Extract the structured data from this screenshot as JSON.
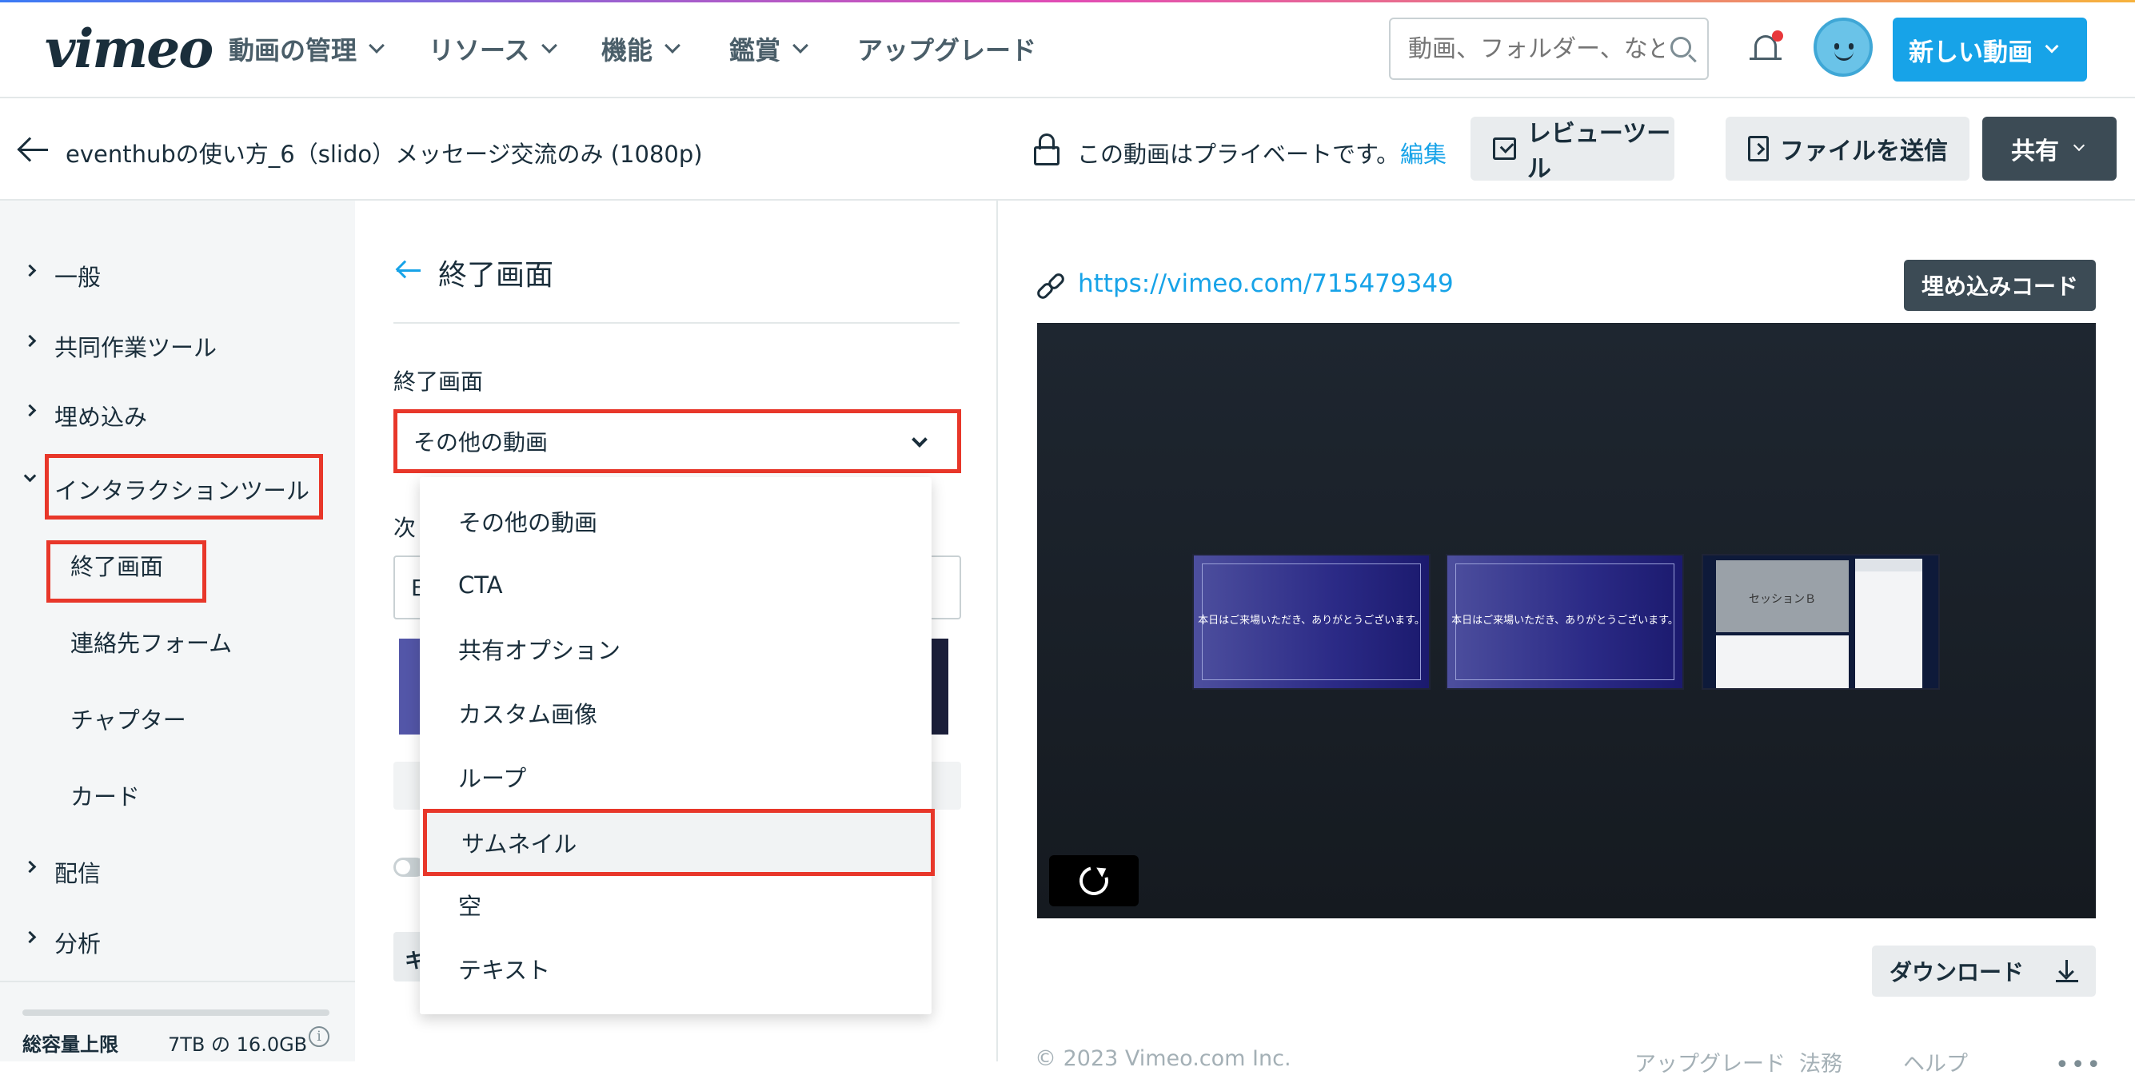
{
  "nav": {
    "logo": "vimeo",
    "items": [
      "動画の管理",
      "リソース",
      "機能",
      "鑑賞",
      "アップグレード"
    ],
    "search_placeholder": "動画、フォルダー、など",
    "new_video": "新しい動画"
  },
  "subheader": {
    "video_title": "eventhubの使い方_6（slido）メッセージ交流のみ (1080p)",
    "privacy_text": "この動画はプライベートです。",
    "edit_link": "編集",
    "review_tool": "レビューツール",
    "send_file": "ファイルを送信",
    "share": "共有"
  },
  "sidebar": {
    "items": [
      "一般",
      "共同作業ツール",
      "埋め込み",
      "インタラクションツール",
      "配信",
      "分析"
    ],
    "subitems": [
      "終了画面",
      "連絡先フォーム",
      "チャプター",
      "カード"
    ],
    "storage_label": "総容量上限",
    "storage_value": "7TB の 16.0GB"
  },
  "middle": {
    "title": "終了画面",
    "field_label": "終了画面",
    "selected_value": "その他の動画",
    "next_label_partial": "次",
    "hidden_input_partial": "E",
    "hidden_button_partial": "キ",
    "dropdown_options": [
      "その他の動画",
      "CTA",
      "共有オプション",
      "カスタム画像",
      "ループ",
      "サムネイル",
      "空",
      "テキスト"
    ],
    "highlighted_option": "サムネイル"
  },
  "right": {
    "url": "https://vimeo.com/715479349",
    "embed_button": "埋め込みコード",
    "thumb_text": "本日はご来場いただき、ありがとうございます。",
    "thumb3_text": "セッションＢ",
    "download": "ダウンロード",
    "footer_copyright": "© 2023 Vimeo.com Inc.",
    "footer_links": [
      "アップグレード",
      "法務",
      "ヘルプ"
    ],
    "footer_more": "•••"
  },
  "colors": {
    "accent": "#17a3e8",
    "highlight_border": "#e8372a",
    "dark_button": "#3c4b55"
  }
}
